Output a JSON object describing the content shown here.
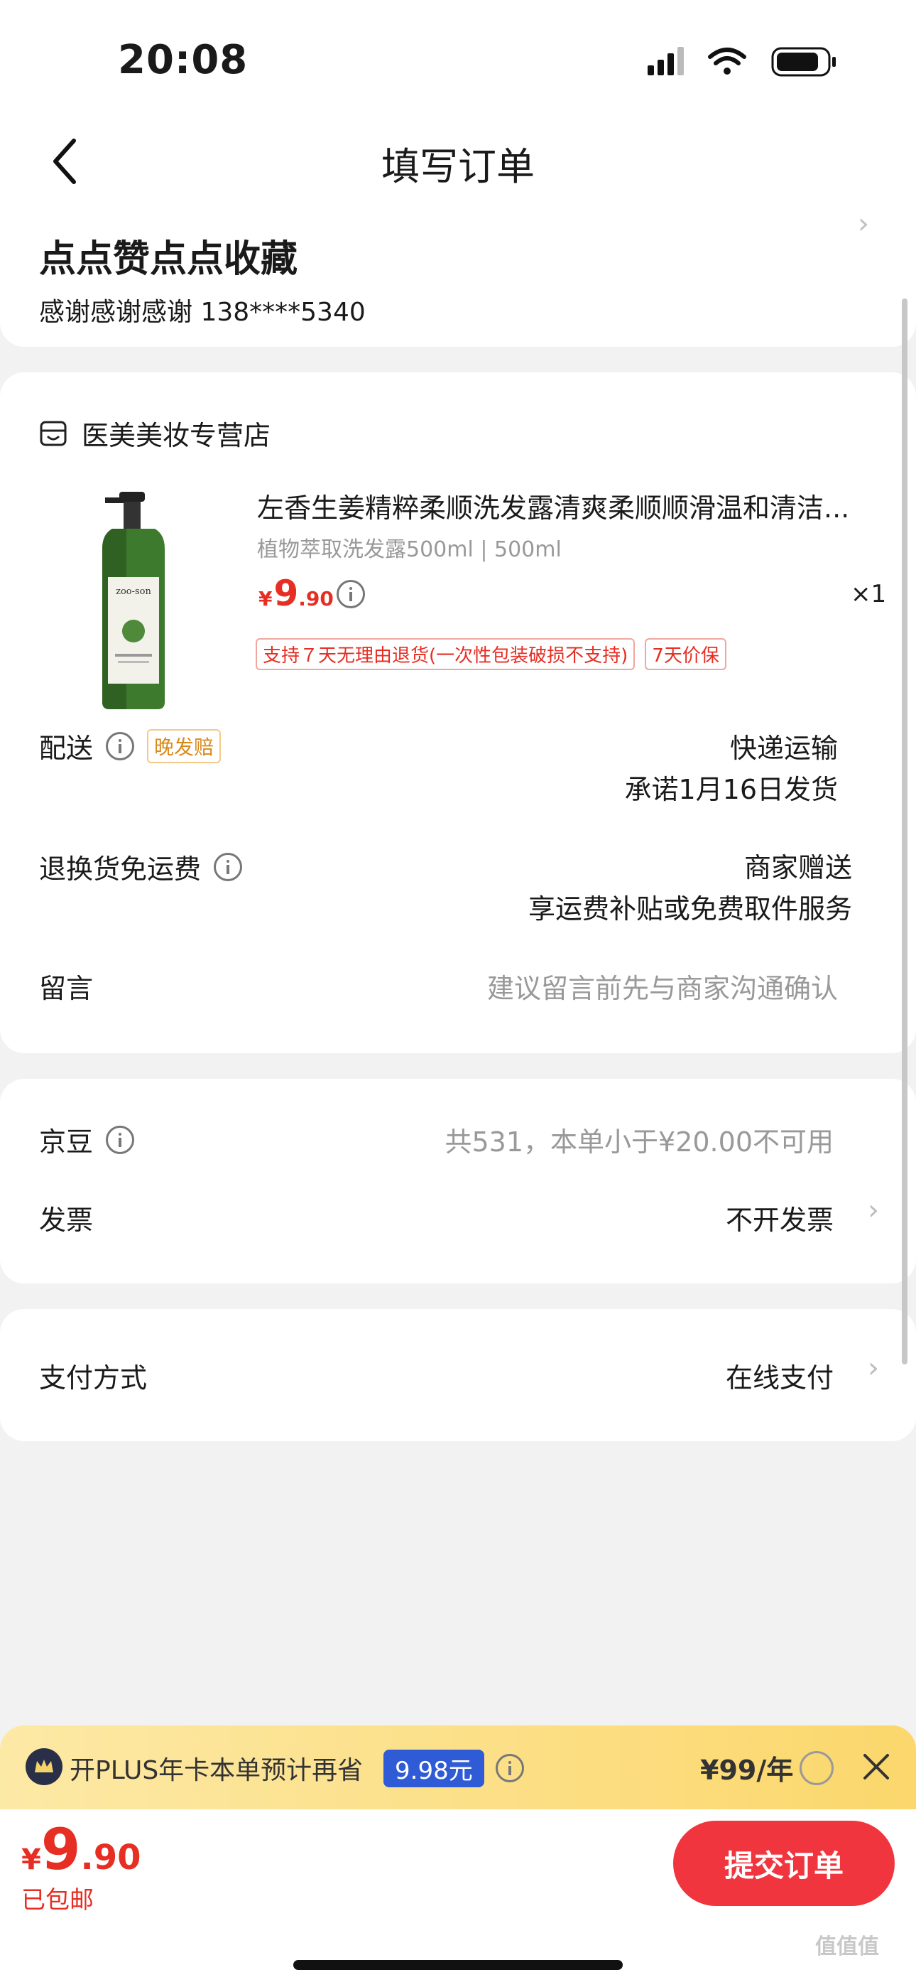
{
  "status_bar": {
    "time": "20:08"
  },
  "nav": {
    "title": "填写订单"
  },
  "address": {
    "name": "点点赞点点收藏",
    "detail": "感谢感谢感谢  138****5340"
  },
  "shop": {
    "name": "医美美妆专营店",
    "product": {
      "title": "左香生姜精粹柔顺洗发露清爽柔顺顺滑温和清洁...",
      "spec": "植物萃取洗发露500ml | 500ml",
      "price_symbol": "¥",
      "price_int": "9",
      "price_dec": ".90",
      "qty": "×1",
      "tags": [
        "支持７天无理由退货(一次性包装破损不支持)",
        "7天价保"
      ]
    },
    "delivery": {
      "label": "配送",
      "tag": "晚发赔",
      "method": "快递运输",
      "promise": "承诺1月16日发货"
    },
    "return_shipping": {
      "label": "退换货免运费",
      "value1": "商家赠送",
      "value2": "享运费补贴或免费取件服务"
    },
    "message": {
      "label": "留言",
      "placeholder": "建议留言前先与商家沟通确认"
    }
  },
  "beans": {
    "label": "京豆",
    "value": "共531，本单小于¥20.00不可用"
  },
  "invoice": {
    "label": "发票",
    "value": "不开发票"
  },
  "payment": {
    "label": "支付方式",
    "value": "在线支付"
  },
  "plus_bar": {
    "text": "开PLUS年卡本单预计再省",
    "save": "9.98元",
    "price": "¥99/年"
  },
  "footer": {
    "price_symbol": "¥",
    "price_int": "9",
    "price_dec": ".90",
    "shipping": "已包邮",
    "submit_label": "提交订单"
  },
  "watermark": "值值值"
}
